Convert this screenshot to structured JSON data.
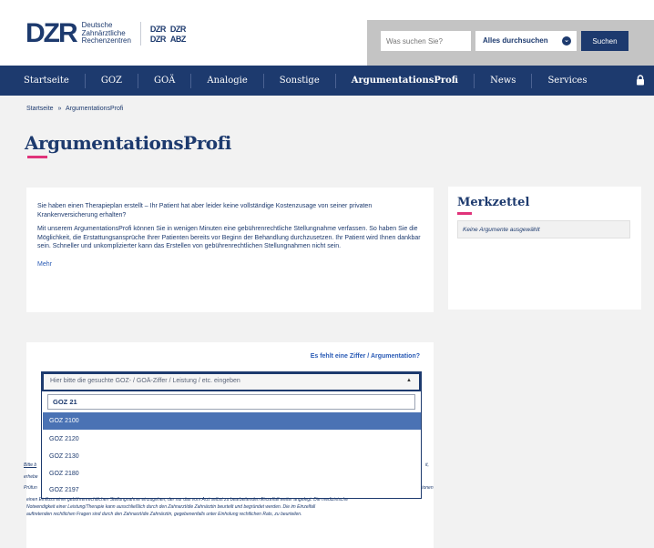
{
  "header": {
    "logo_main": "DZR",
    "logo_text": [
      "Deutsche",
      "Zahnärztliche",
      "Rechenzentren"
    ],
    "sub_logos": [
      "DZR",
      "DZR",
      "DZR",
      "ABZ"
    ],
    "search_placeholder": "Was suchen Sie?",
    "search_scope": "Alles durchsuchen",
    "search_button": "Suchen"
  },
  "nav": {
    "items": [
      "Startseite",
      "GOZ",
      "GOÄ",
      "Analogie",
      "Sonstige",
      "ArgumentationsProfi",
      "News",
      "Services"
    ],
    "active": "ArgumentationsProfi"
  },
  "breadcrumb": {
    "home": "Startseite",
    "sep": "»",
    "current": "ArgumentationsProfi"
  },
  "page_title": "ArgumentationsProfi",
  "intro": {
    "p1": "Sie haben einen Therapieplan erstellt – Ihr Patient hat aber leider keine vollständige Kostenzusage von seiner privaten Krankenversicherung erhalten?",
    "p2": "Mit unserem ArgumentationsProfi können Sie in wenigen Minuten eine gebührenrechtliche Stellungnahme verfassen. So haben Sie die Möglichkeit, die Erstattungsansprüche Ihrer Patienten bereits vor Beginn der Behandlung durchzusetzen. Ihr Patient wird Ihnen dankbar sein. Schneller und unkomplizierter kann das Erstellen von gebührenrechtlichen Stellungnahmen nicht sein.",
    "more": "Mehr"
  },
  "merkzettel": {
    "title": "Merkzettel",
    "empty": "Keine Argumente ausgewählt"
  },
  "search": {
    "missing_link": "Es fehlt eine Ziffer / Argumentation?",
    "dropdown_placeholder": "Hier bitte die gesuchte GOZ- / GOÄ-Ziffer / Leistung / etc. eingeben",
    "query": "GOZ 21",
    "options": [
      "GOZ 2100",
      "GOZ 2120",
      "GOZ 2130",
      "GOZ 2180",
      "GOZ 2197"
    ],
    "selected_index": 0
  },
  "footnote": {
    "left": [
      "Bitte b",
      "erhebe",
      "Prüfun"
    ],
    "right": [
      "it,",
      "tionen"
    ],
    "line1": "einen Einfluss einer gebührenrechtlichen Stellungnahme einzugehen, der nur das vom Arzt selbst zu bearbeitenden Einzelfall weiter angelegt. Die medizinische",
    "line2": "Notwendigkeit einer Leistung/Therapie kann ausschließlich durch den Zahnarzt/die Zahnärztin beurteilt und begründet werden. Die im Einzelfall",
    "line3": "auftretenden rechtlichen Fragen sind durch den Zahnarzt/die Zahnärztin, gegebenenfalls unter Einholung rechtlichen Rats, zu beurteilen."
  }
}
